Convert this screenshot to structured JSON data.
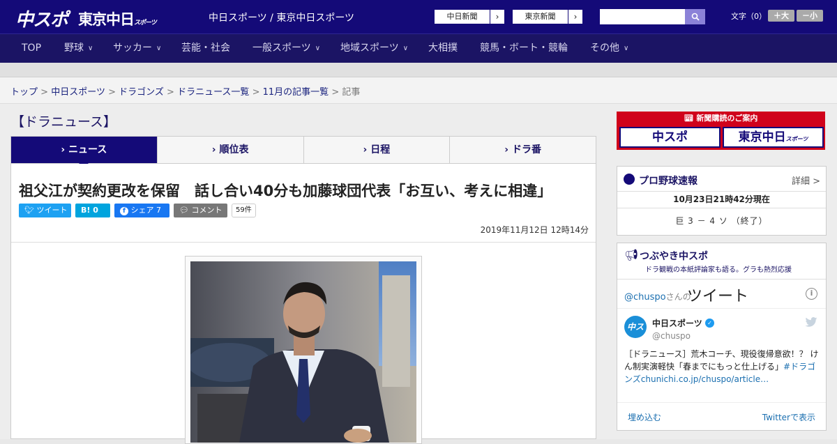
{
  "header": {
    "logo_chuspo": "中スポ",
    "logo_tokyo": "東京中日",
    "logo_tokyo_sub": "スポーツ",
    "site_title": "中日スポーツ / 東京中日スポーツ",
    "ext_links": [
      "中日新聞",
      "東京新聞"
    ],
    "search_placeholder": "",
    "font_size_label": "文字（0）",
    "font_bigger": "＋大",
    "font_smaller": "－小"
  },
  "nav": {
    "items": [
      {
        "label": "TOP",
        "has_menu": false
      },
      {
        "label": "野球",
        "has_menu": true
      },
      {
        "label": "サッカー",
        "has_menu": true
      },
      {
        "label": "芸能・社会",
        "has_menu": false
      },
      {
        "label": "一般スポーツ",
        "has_menu": true
      },
      {
        "label": "地域スポーツ",
        "has_menu": true
      },
      {
        "label": "大相撲",
        "has_menu": false
      },
      {
        "label": "競馬・ボート・競輪",
        "has_menu": false
      },
      {
        "label": "その他",
        "has_menu": true
      }
    ]
  },
  "breadcrumb": {
    "items": [
      "トップ",
      "中日スポーツ",
      "ドラゴンズ",
      "ドラニュース一覧",
      "11月の記事一覧"
    ],
    "current": "記事",
    "separator": ">"
  },
  "section": {
    "heading": "【ドラニュース】",
    "tabs": [
      "ニュース",
      "順位表",
      "日程",
      "ドラ番"
    ],
    "active_tab": 0
  },
  "article": {
    "headline": "祖父江が契約更改を保留　話し合い40分も加藤球団代表「お互い、考えに相違」",
    "share": {
      "tweet": "ツイート",
      "hatena": "B! 0",
      "facebook": "シェア 7",
      "comment": "コメント",
      "comment_count": "59件"
    },
    "date": "2019年11月12日 12時14分"
  },
  "sidebar": {
    "subscribe": {
      "title": "新聞購読のご案内",
      "buttons": [
        "中スポ",
        "東京中日"
      ],
      "button_sub": "スポーツ"
    },
    "baseball": {
      "title": "プロ野球速報",
      "detail": "詳細 >",
      "timestamp": "10月23日21時42分現在",
      "score": "巨 3 － 4 ソ （終了）"
    },
    "tweets": {
      "title": "つぶやき中スポ",
      "subtitle": "ドラ観戦の本紙評論家も語る。グラも熱烈応援",
      "handle": "@chuspo",
      "handle_suffix": "さんの",
      "timeline_title": "ツイート",
      "account_name": "中日スポーツ",
      "account_handle": "@chuspo",
      "avatar_text": "中スポ",
      "tweet_text": "［ドラニュース］荒木コーチ、現役復帰意欲！？ けん制実演軽快「春までにもっと仕上げる」",
      "tweet_hashtag": "#ドラゴンズ",
      "tweet_link": "chunichi.co.jp/chuspo/article…",
      "embed": "埋め込む",
      "view_on_twitter": "Twitterで表示"
    }
  },
  "colors": {
    "brand_navy": "#140a78",
    "nav_bg": "#1b1464",
    "subscribe_red": "#d0021b",
    "twitter_blue": "#1d9bf0",
    "facebook_blue": "#1877f2",
    "hatena_blue": "#00a4de"
  }
}
